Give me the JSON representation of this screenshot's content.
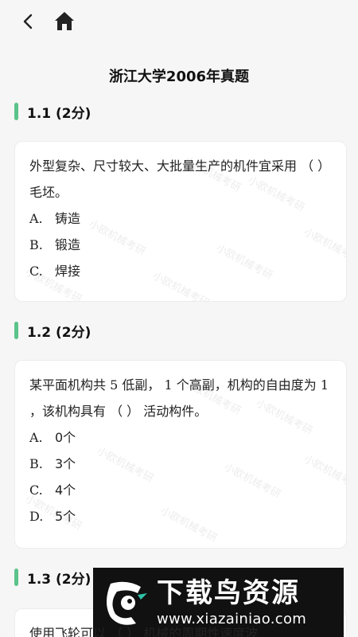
{
  "nav": {
    "back_icon": "chevron-left-icon",
    "home_icon": "home-icon"
  },
  "page_title": "浙江大学2006年真题",
  "sections": [
    {
      "label": "1.1 (2分)",
      "question_parts": [
        "外型复杂、尺寸较大、大批量生产的机件宜采用 （      ） 毛坯。"
      ],
      "options": [
        {
          "letter": "A.",
          "text": "铸造"
        },
        {
          "letter": "B.",
          "text": "锻造"
        },
        {
          "letter": "C.",
          "text": "焊接"
        }
      ]
    },
    {
      "label": "1.2 (2分)",
      "question_prefix": "某平面机构共",
      "question_n1": "5",
      "question_mid1": "低副，",
      "question_n2": "1",
      "question_mid2": "个高副，机构的自由度为",
      "question_n3": "1",
      "question_suffix": "，该机构具有 （      ） 活动构件。",
      "options": [
        {
          "letter": "A.",
          "text": "0个"
        },
        {
          "letter": "B.",
          "text": "3个"
        },
        {
          "letter": "C.",
          "text": "4个"
        },
        {
          "letter": "D.",
          "text": "5个"
        }
      ]
    },
    {
      "label": "1.3 (2分)",
      "question_visible": "使用飞轮可以 （      ） 机械的周期性速度波"
    }
  ],
  "watermark": "小欧机械考研",
  "overlay": {
    "brand": "下载鸟资源",
    "url": "www.xiazainiao.com"
  },
  "colors": {
    "accent": "#5cc38a",
    "background": "#f6f6f6"
  }
}
